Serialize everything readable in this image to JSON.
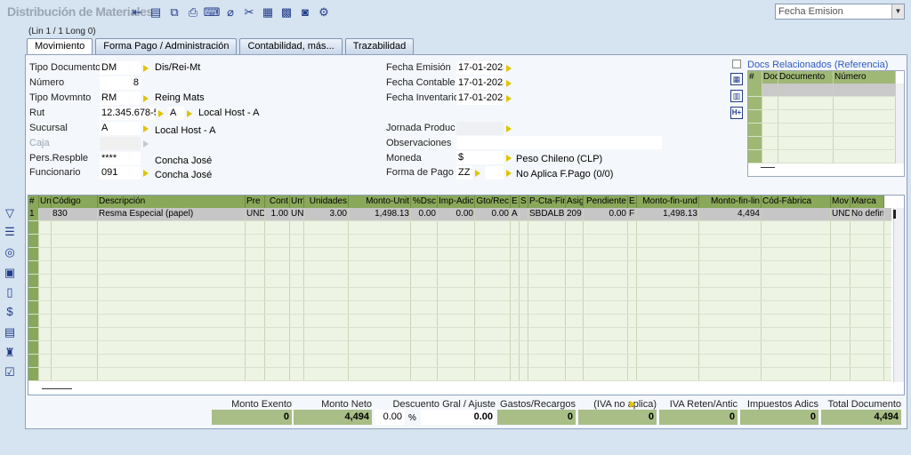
{
  "window": {
    "title": "Distribución de Materiales",
    "order_select": "Fecha Emision",
    "line_info": "(Lin 1 / 1 Long 0)"
  },
  "toolbar": [
    {
      "name": "back-icon",
      "glyph": "⇤"
    },
    {
      "name": "save-icon",
      "glyph": "▤"
    },
    {
      "name": "copy-icon",
      "glyph": "⧉"
    },
    {
      "name": "print-icon",
      "glyph": "⎙"
    },
    {
      "name": "export-icon",
      "glyph": "⌨"
    },
    {
      "name": "cancel-icon",
      "glyph": "⌀"
    },
    {
      "name": "tools-icon",
      "glyph": "✂"
    },
    {
      "name": "report-icon",
      "glyph": "▦"
    },
    {
      "name": "calc-icon",
      "glyph": "▩"
    },
    {
      "name": "message-icon",
      "glyph": "◙"
    },
    {
      "name": "settings-icon",
      "glyph": "⚙"
    }
  ],
  "tabs": [
    "Movimiento",
    "Forma Pago / Administración",
    "Contabilidad, más...",
    "Trazabilidad"
  ],
  "form": {
    "tipo_documento": {
      "label": "Tipo Documento",
      "value": "DM",
      "desc": "Dis/Rei-Mt"
    },
    "numero": {
      "label": "Número",
      "value": "8"
    },
    "tipo_movimiento": {
      "label": "Tipo Movmnto",
      "value": "RM",
      "desc": "Reing Mats"
    },
    "rut": {
      "label": "Rut",
      "value": "12.345.678-5",
      "sub": "A",
      "desc": "Local Host - A"
    },
    "sucursal": {
      "label": "Sucursal",
      "value": "A",
      "desc": "Local Host - A"
    },
    "caja": {
      "label": "Caja",
      "value": ""
    },
    "pers_resp": {
      "label": "Pers.Respble",
      "value": "****",
      "desc": "Concha José"
    },
    "funcionario": {
      "label": "Funcionario",
      "value": "091",
      "desc": "Concha José"
    },
    "fecha_emision": {
      "label": "Fecha Emisión",
      "value": "17-01-2023"
    },
    "fecha_contable": {
      "label": "Fecha Contable",
      "value": "17-01-2023"
    },
    "fecha_inventario": {
      "label": "Fecha Inventario",
      "value": "17-01-2023"
    },
    "jornada": {
      "label": "Jornada Produc",
      "value": ""
    },
    "observaciones": {
      "label": "Observaciones",
      "value": ""
    },
    "moneda": {
      "label": "Moneda",
      "value": "$",
      "desc": "Peso Chileno (CLP)"
    },
    "forma_pago": {
      "label": "Forma de Pago",
      "value": "ZZ",
      "desc": "No Aplica F.Pago (0/0)"
    }
  },
  "docs": {
    "checkbox_label": "Docs Relacionados (Referencia)",
    "headers": [
      "#",
      "Doc",
      "Documento",
      "Número"
    ]
  },
  "grid": {
    "headers": [
      "#",
      "Un",
      "Código",
      "Descripción",
      "Pre",
      "Cont",
      "Um",
      "Unidades",
      "Monto-Unit",
      "%Dsc",
      "Imp-Adic",
      "Gto/Rec",
      "E",
      "S",
      "P-Cta-Fin",
      "Asig",
      "Pendiente",
      "E.",
      "Monto-fin-und",
      "Monto-fin-lin",
      "Cód-Fábrica",
      "Mov",
      "Marca"
    ],
    "row": [
      "1",
      "",
      "830",
      "Resma Especial (papel)",
      "UND",
      "1.00",
      "UN",
      "3.00",
      "1,498.13",
      "0.00",
      "0.00",
      "0.00",
      "A",
      "",
      "SBDALB",
      "209",
      "0.00",
      "F",
      "1,498.13",
      "4,494",
      "",
      "UND",
      "No definid"
    ]
  },
  "totals": [
    {
      "label": "Monto Exento",
      "value": "0"
    },
    {
      "label": "Monto Neto",
      "value": "4,494"
    },
    {
      "label": "Descuento Gral / Ajuste",
      "pct": "0.00",
      "pct_sign": "%",
      "value": "0.00"
    },
    {
      "label": "Gastos/Recargos",
      "value": "0"
    },
    {
      "label": "(IVA no aplica)",
      "value": "0"
    },
    {
      "label": "IVA Reten/Antic",
      "value": "0"
    },
    {
      "label": "Impuestos Adics",
      "value": "0"
    },
    {
      "label": "Total Documento",
      "value": "4,494"
    }
  ],
  "sidebar": [
    {
      "name": "filter-icon",
      "glyph": "▽"
    },
    {
      "name": "list-icon",
      "glyph": "☰"
    },
    {
      "name": "target-icon",
      "glyph": "◎"
    },
    {
      "name": "calendar-icon",
      "glyph": "▣"
    },
    {
      "name": "book-icon",
      "glyph": "▯"
    },
    {
      "name": "money-icon",
      "glyph": "$"
    },
    {
      "name": "document-icon",
      "glyph": "▤"
    },
    {
      "name": "stamp-icon",
      "glyph": "♜"
    },
    {
      "name": "checklist-icon",
      "glyph": "☑"
    }
  ]
}
